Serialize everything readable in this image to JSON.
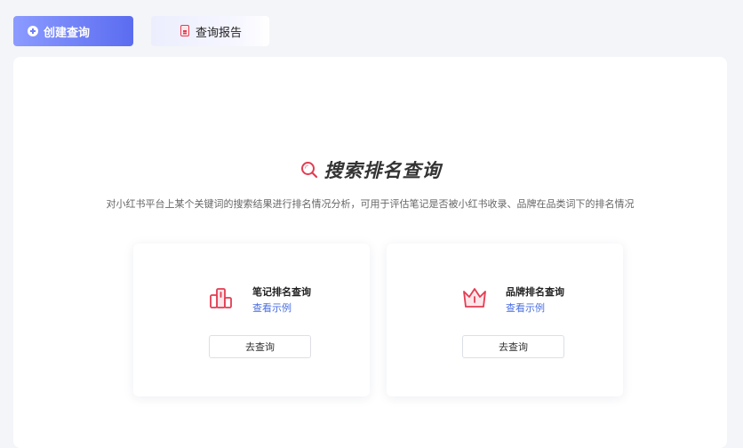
{
  "tabs": {
    "create_label": "创建查询",
    "report_label": "查询报告"
  },
  "main": {
    "title": "搜索排名查询",
    "subtitle": "对小红书平台上某个关键词的搜索结果进行排名情况分析，可用于评估笔记是否被小红书收录、品牌在品类词下的排名情况"
  },
  "cards": [
    {
      "title": "笔记排名查询",
      "link": "查看示例",
      "button": "去查询",
      "icon": "podium-icon"
    },
    {
      "title": "品牌排名查询",
      "link": "查看示例",
      "button": "去查询",
      "icon": "crown-icon"
    }
  ],
  "colors": {
    "accent": "#5b6cf0",
    "icon_red": "#e23d52",
    "link": "#4a6ee0"
  }
}
